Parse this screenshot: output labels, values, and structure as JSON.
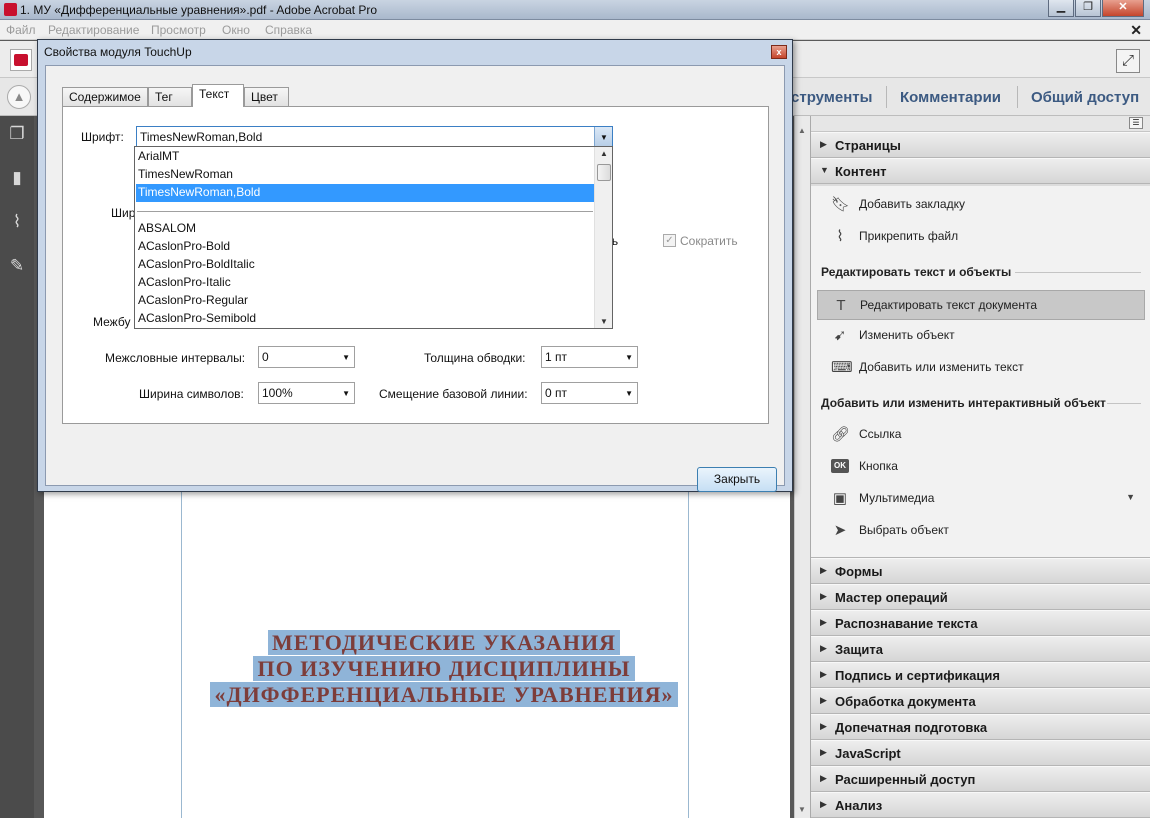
{
  "window": {
    "title": "1. МУ «Дифференциальные уравнения».pdf - Adobe Acrobat Pro",
    "buttons": {
      "minimize": "▁",
      "maximize": "❐",
      "close": "✕"
    }
  },
  "menu": [
    "Файл",
    "Редактирование",
    "Просмотр",
    "Окно",
    "Справка"
  ],
  "top_links": {
    "tools": "струменты",
    "comments": "Комментарии",
    "share": "Общий доступ"
  },
  "dialog": {
    "title": "Свойства модуля TouchUp",
    "close_glyph": "x",
    "tabs": [
      "Содержимое",
      "Тег",
      "Текст",
      "Цвет"
    ],
    "active_tab": "Текст",
    "font_label": "Шрифт:",
    "font_value": "TimesNewRoman,Bold",
    "partial_label_1": "Шири",
    "partial_label_2": "Межбу",
    "partial_checkbox_text": "рить",
    "shrink_label": "Сократить",
    "word_spacing_label": "Межсловные интервалы:",
    "word_spacing_value": "0",
    "char_width_label": "Ширина символов:",
    "char_width_value": "100%",
    "stroke_label": "Толщина обводки:",
    "stroke_value": "1 пт",
    "baseline_label": "Смещение базовой линии:",
    "baseline_value": "0 пт",
    "close_button": "Закрыть",
    "font_list": [
      "ArialMT",
      "TimesNewRoman",
      "TimesNewRoman,Bold",
      "ABSALOM",
      "ACaslonPro-Bold",
      "ACaslonPro-BoldItalic",
      "ACaslonPro-Italic",
      "ACaslonPro-Regular",
      "ACaslonPro-Semibold"
    ],
    "font_list_selected": "TimesNewRoman,Bold"
  },
  "document": {
    "lines": [
      "МЕТОДИЧЕСКИЕ УКАЗАНИЯ",
      "ПО ИЗУЧЕНИЮ ДИСЦИПЛИНЫ",
      "«ДИФФЕРЕНЦИАЛЬНЫЕ УРАВНЕНИЯ»"
    ]
  },
  "right_panel": {
    "panels": [
      "Страницы",
      "Контент",
      "Формы",
      "Мастер операций",
      "Распознавание текста",
      "Защита",
      "Подпись и сертификация",
      "Обработка документа",
      "Допечатная подготовка",
      "JavaScript",
      "Расширенный доступ",
      "Анализ"
    ],
    "content_items_1": [
      "Добавить закладку",
      "Прикрепить файл"
    ],
    "section_edit": "Редактировать текст и объекты",
    "edit_items": [
      "Редактировать текст документа",
      "Изменить объект",
      "Добавить или изменить текст"
    ],
    "section_interactive": "Добавить или изменить интерактивный объект",
    "interactive_items": [
      "Ссылка",
      "Кнопка",
      "Мультимедиа",
      "Выбрать объект"
    ],
    "ok_icon_text": "OK"
  },
  "colors": {
    "selection": "#3399ff",
    "accent": "#3c5a82",
    "highlight": "#8fb4d8"
  }
}
